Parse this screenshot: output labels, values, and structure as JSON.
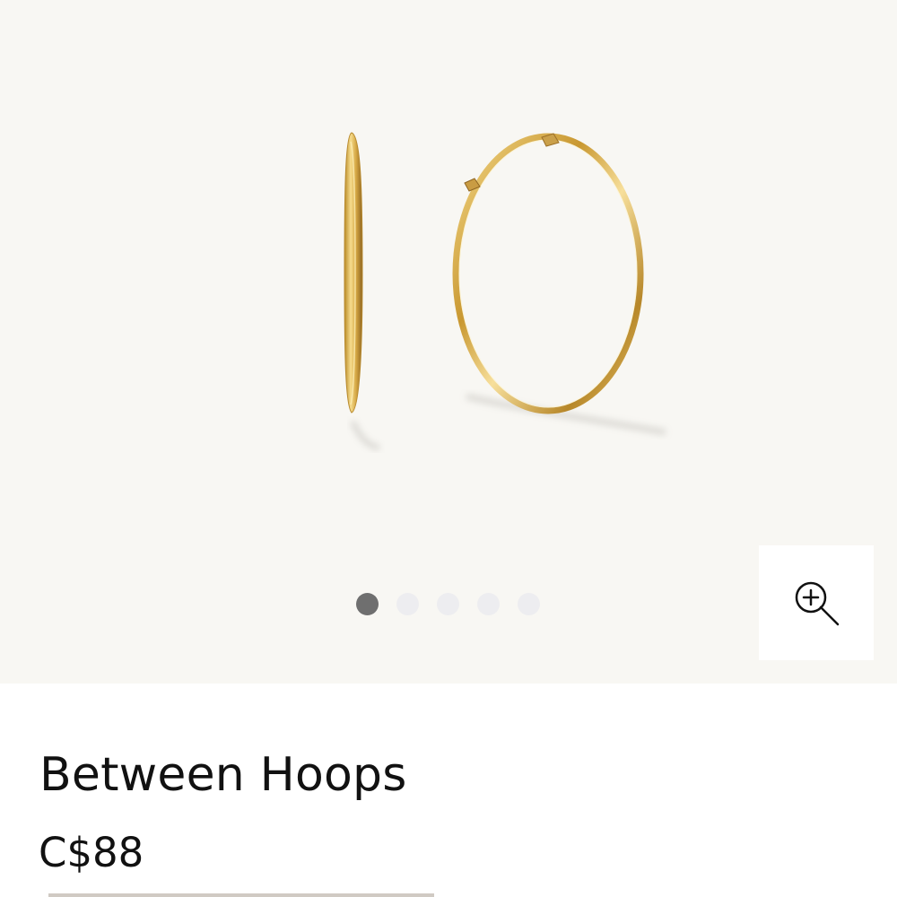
{
  "product": {
    "title": "Between Hoops",
    "price": "C$88"
  },
  "gallery": {
    "image_subject": "gold hoop earrings",
    "slide_count": 5,
    "active_slide": 1,
    "zoom_icon": "zoom-in-icon"
  },
  "colors": {
    "gallery_background": "#f8f7f3",
    "gold": "#d8b45a",
    "text": "#111111",
    "active_dot": "#6f6f6f",
    "inactive_dot": "#ededf0"
  }
}
